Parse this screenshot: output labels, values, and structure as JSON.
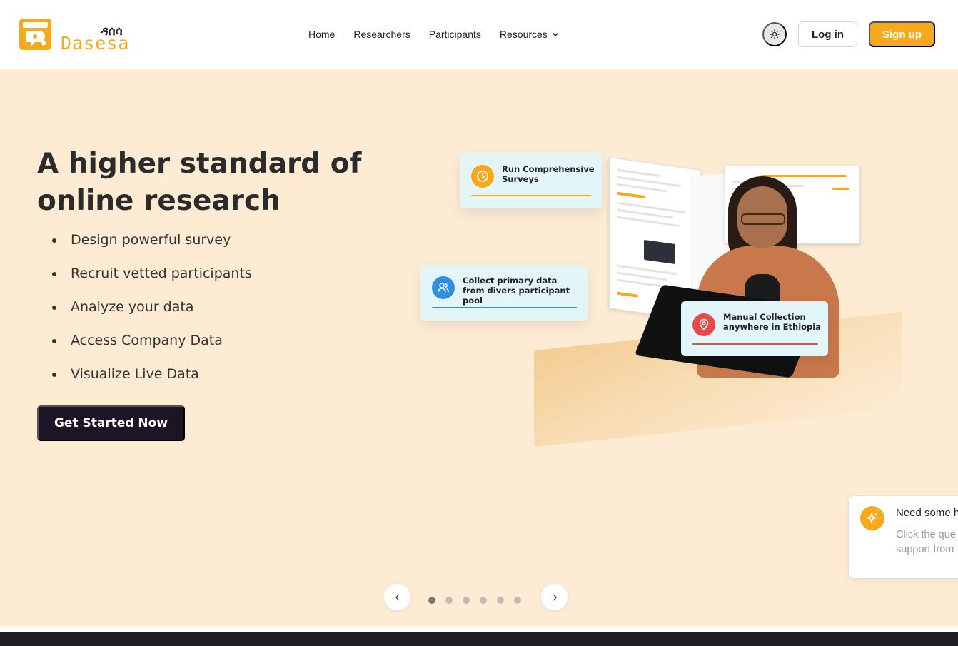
{
  "brand": {
    "name_amharic": "ዳሰሳ",
    "name_english": "Dasesa",
    "accent_color": "#f6a91c",
    "logo_icon": "dasesa-logo-icon"
  },
  "nav": {
    "items": [
      {
        "label": "Home"
      },
      {
        "label": "Researchers"
      },
      {
        "label": "Participants"
      },
      {
        "label": "Resources",
        "icon": "chevron-down-icon"
      }
    ],
    "theme_toggle_icon": "sun-icon",
    "login_label": "Log in",
    "signup_label": "Sign up"
  },
  "hero": {
    "title": "A higher standard of online research",
    "bullets": [
      "Design powerful survey",
      "Recruit vetted participants",
      "Analyze your data",
      "Access Company Data",
      "Visualize Live Data"
    ],
    "cta_label": "Get Started Now",
    "background_color": "#fdebd3"
  },
  "illustration_cards": [
    {
      "text": "Run Comprehensive Surveys",
      "icon": "clock-icon",
      "color": "#f6a91c"
    },
    {
      "text": "Collect primary data from divers participant pool",
      "icon": "users-icon",
      "color": "#2f8fe0"
    },
    {
      "text": "Manual Collection anywhere in Ethiopia",
      "icon": "map-pin-icon",
      "color": "#e8494a"
    }
  ],
  "help_toast": {
    "icon": "sparkles-icon",
    "title": "Need some h",
    "body": "Click the que anytime to g support from"
  },
  "carousel": {
    "prev_icon": "chevron-left-icon",
    "next_icon": "chevron-right-icon",
    "slide_count": 6,
    "active_index": 0
  }
}
